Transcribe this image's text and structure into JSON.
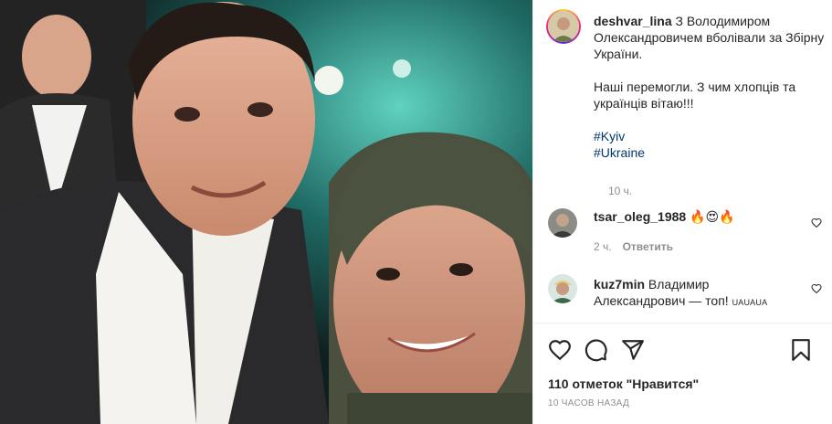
{
  "post": {
    "author": "deshvar_lina",
    "caption_lines": [
      "З Володимиром Олександровичем вболівали за Збірну України."
    ],
    "caption_paragraph2": "Наші перемогли. З чим хлопців та українців вітаю!!!",
    "hashtags": [
      "#Kyiv",
      "#Ukraine"
    ],
    "caption_time": "10 ч."
  },
  "comments": [
    {
      "username": "tsar_oleg_1988",
      "text": "🔥😍🔥",
      "time": "2 ч.",
      "reply_label": "Ответить"
    },
    {
      "username": "kuz7min",
      "text": "Владимир Александрович — топ!",
      "badge": "UAUAUA"
    }
  ],
  "footer": {
    "likes": "110 отметок \"Нравится\"",
    "time": "10 ЧАСОВ НАЗАД"
  },
  "icons": [
    "heart-icon",
    "comment-icon",
    "share-icon",
    "bookmark-icon"
  ]
}
